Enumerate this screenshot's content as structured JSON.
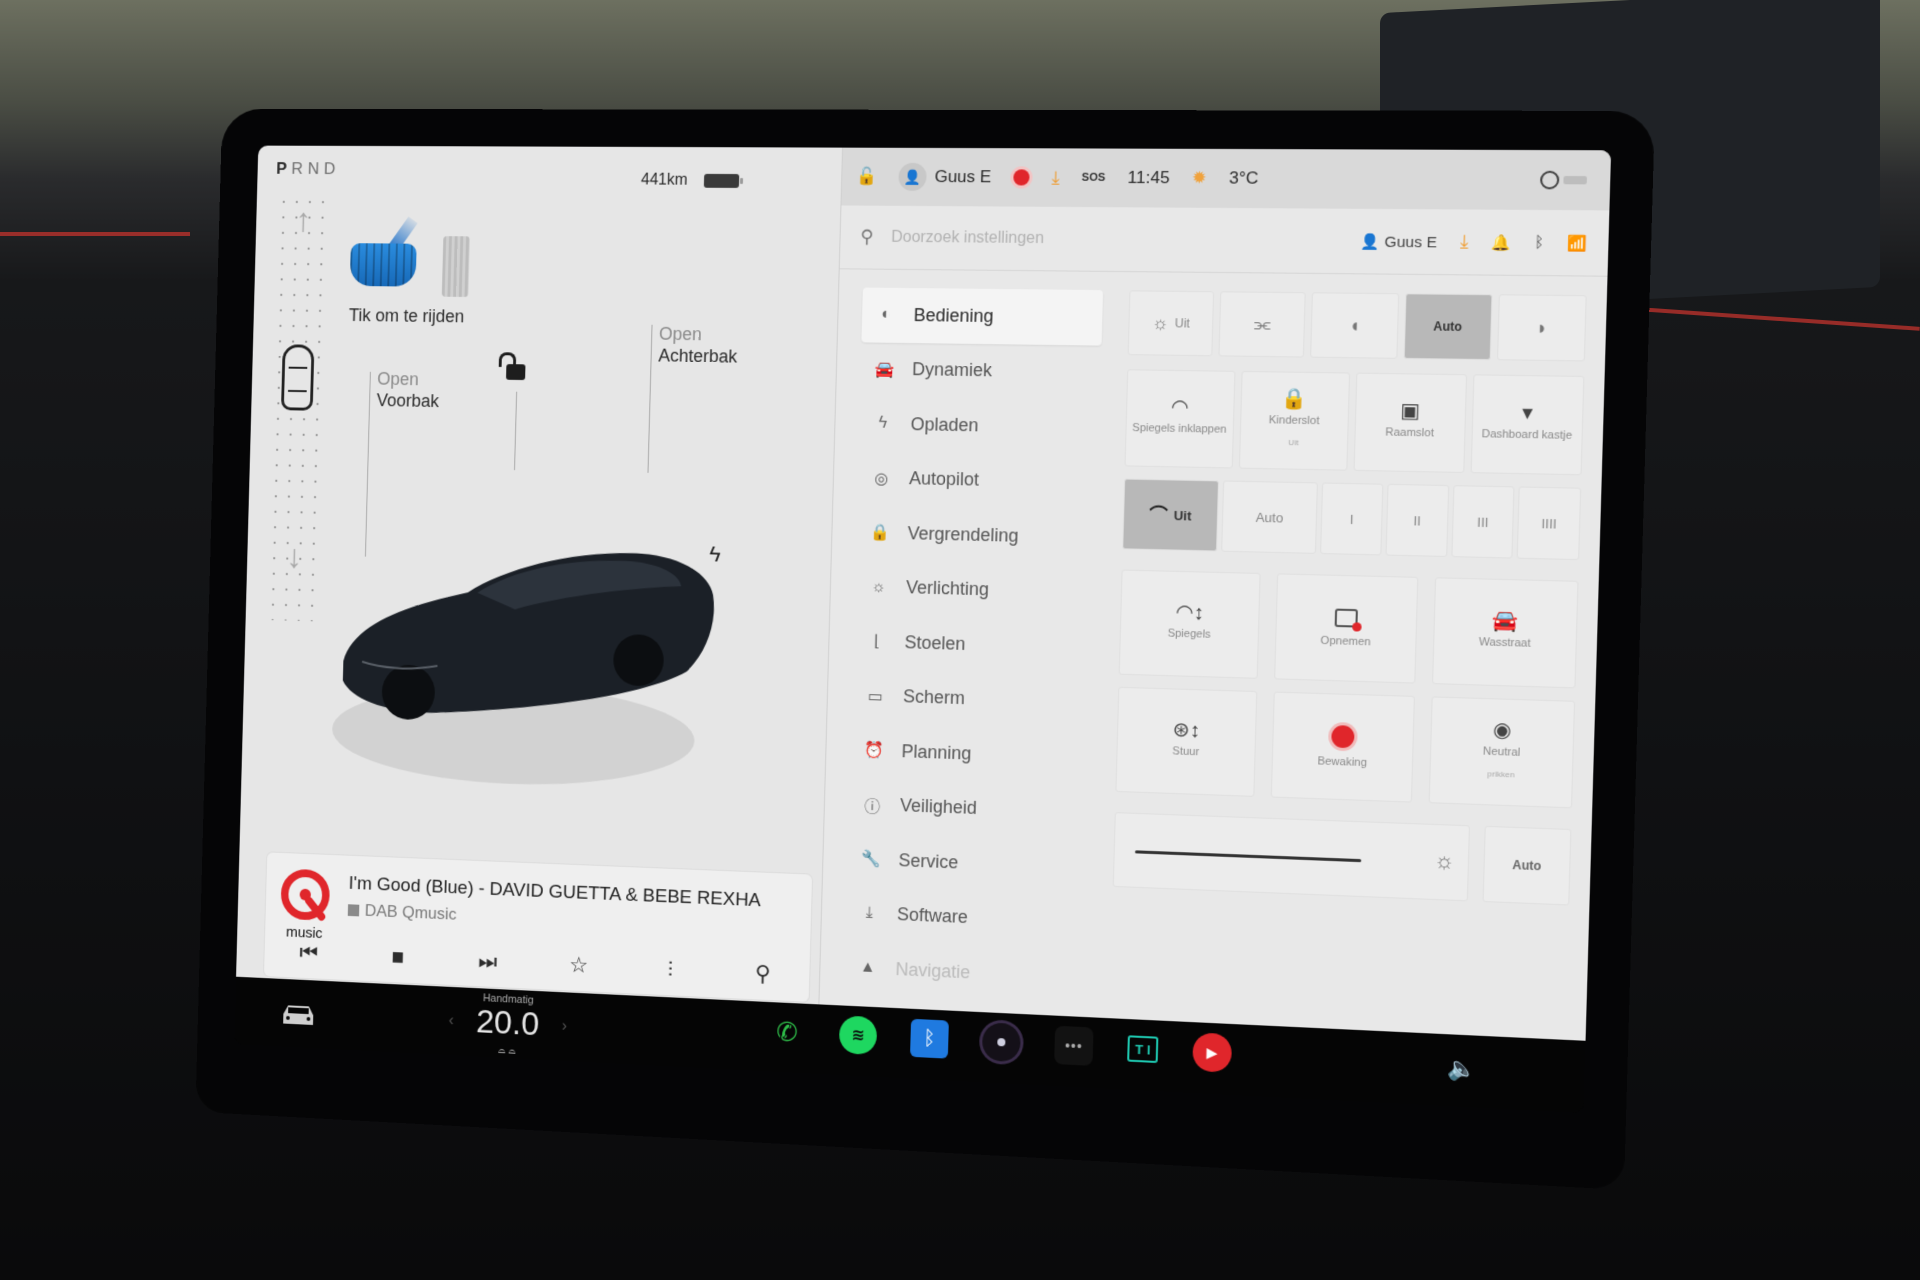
{
  "drive": {
    "gears": [
      "P",
      "R",
      "N",
      "D"
    ],
    "active_gear": "P",
    "tap_to_drive": "Tik om te rijden",
    "range": "441km"
  },
  "car_view": {
    "frunk": {
      "action": "Open",
      "label": "Voorbak"
    },
    "trunk": {
      "action": "Open",
      "label": "Achterbak"
    },
    "lock_state": "unlocked",
    "charge_port_icon": "bolt"
  },
  "media": {
    "station_logo": "music",
    "track": "I'm Good (Blue) - DAVID GUETTA & BEBE REXHA",
    "source": "DAB Qmusic",
    "controls": [
      "previous",
      "stop",
      "next",
      "favorite",
      "equalizer",
      "search"
    ],
    "controls_glyphs": [
      "⏮",
      "■",
      "⏭",
      "☆",
      "⫶",
      "⚲"
    ],
    "page_dots": "• • •"
  },
  "status_bar": {
    "user": "Guus E",
    "time": "11:45",
    "temperature": "3°C",
    "sos": "SOS"
  },
  "settings": {
    "search_placeholder": "Doorzoek instellingen",
    "profile": "Guus E",
    "menu": [
      {
        "label": "Bediening",
        "icon": "◐",
        "active": true
      },
      {
        "label": "Dynamiek",
        "icon": "🚘",
        "active": false
      },
      {
        "label": "Opladen",
        "icon": "ϟ",
        "active": false
      },
      {
        "label": "Autopilot",
        "icon": "◎",
        "active": false
      },
      {
        "label": "Vergrendeling",
        "icon": "🔒",
        "active": false
      },
      {
        "label": "Verlichting",
        "icon": "☼",
        "active": false
      },
      {
        "label": "Stoelen",
        "icon": "⌊",
        "active": false
      },
      {
        "label": "Scherm",
        "icon": "▭",
        "active": false
      },
      {
        "label": "Planning",
        "icon": "⏰",
        "active": false
      },
      {
        "label": "Veiligheid",
        "icon": "ⓘ",
        "active": false
      },
      {
        "label": "Service",
        "icon": "🔧",
        "active": false
      },
      {
        "label": "Software",
        "icon": "⤓",
        "active": false
      },
      {
        "label": "Navigatie",
        "icon": "▲",
        "active": false
      }
    ],
    "lights": {
      "options": [
        {
          "label": "Uit",
          "icon": "☼"
        },
        {
          "label": "",
          "icon": "⫘"
        },
        {
          "label": "",
          "icon": "◖"
        },
        {
          "label": "Auto",
          "icon": ""
        },
        {
          "label": "",
          "icon": "◗"
        }
      ],
      "selected": "Auto"
    },
    "quick_tiles": [
      {
        "label": "Spiegels inklappen",
        "icon": "◠",
        "sub": ""
      },
      {
        "label": "Kinderslot",
        "icon": "🔒",
        "sub": "Uit"
      },
      {
        "label": "Raamslot",
        "icon": "▣",
        "sub": ""
      },
      {
        "label": "Dashboard kastje",
        "icon": "▾",
        "sub": ""
      }
    ],
    "wipers": {
      "options": [
        "Uit",
        "Auto",
        "I",
        "II",
        "III",
        "IIII"
      ],
      "selected": "Uit"
    },
    "big_tiles": [
      {
        "label": "Spiegels",
        "icon": "◠↕"
      },
      {
        "label": "Opnemen",
        "icon": "cam-rec"
      },
      {
        "label": "Wasstraat",
        "icon": "🚘"
      },
      {
        "label": "Stuur",
        "icon": "⊛↕"
      },
      {
        "label": "Bewaking",
        "icon": "rec"
      },
      {
        "label": "Neutral",
        "icon": "◉",
        "sub": "prikken"
      }
    ],
    "brightness": {
      "value_fraction": 0.78,
      "auto_label": "Auto"
    }
  },
  "dock": {
    "climate_mode": "Handmatig",
    "temperature": "20.0",
    "apps": [
      {
        "name": "phone",
        "glyph": "✆"
      },
      {
        "name": "spotify",
        "glyph": "≋"
      },
      {
        "name": "bluetooth",
        "glyph": "ᛒ"
      },
      {
        "name": "camera",
        "glyph": ""
      },
      {
        "name": "more",
        "glyph": "•••"
      },
      {
        "name": "toybox",
        "glyph": "T I"
      },
      {
        "name": "youtube-music",
        "glyph": "▶"
      }
    ],
    "volume_glyph": "🔈"
  },
  "colors": {
    "accent_blue": "#1f7ae0",
    "record_red": "#e0262b",
    "spotify_green": "#1ed760",
    "download_orange": "#f09a2a"
  }
}
